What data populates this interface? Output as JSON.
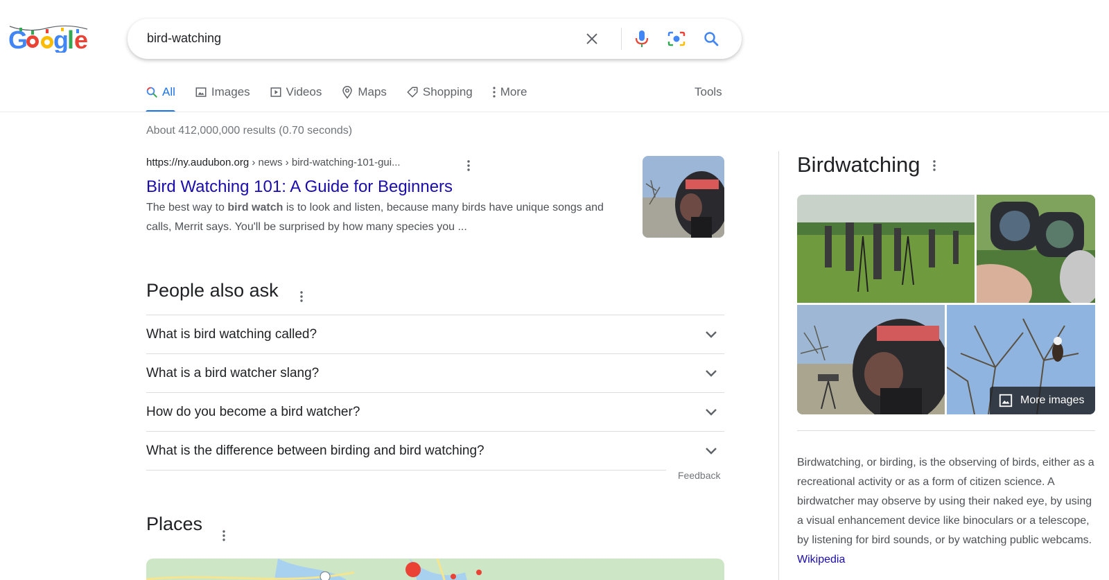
{
  "search": {
    "query": "bird-watching"
  },
  "tabs": [
    {
      "label": "All",
      "icon": "search-icon"
    },
    {
      "label": "Images",
      "icon": "image-icon"
    },
    {
      "label": "Videos",
      "icon": "video-icon"
    },
    {
      "label": "Maps",
      "icon": "map-pin-icon"
    },
    {
      "label": "Shopping",
      "icon": "tag-icon"
    },
    {
      "label": "More",
      "icon": "more-vert-icon"
    }
  ],
  "tools_label": "Tools",
  "stats": "About 412,000,000 results (0.70 seconds)",
  "result": {
    "domain": "https://ny.audubon.org",
    "path": " › news › bird-watching-101-gui...",
    "title": "Bird Watching 101: A Guide for Beginners",
    "snippet_pre": "The best way to ",
    "snippet_bold": "bird watch",
    "snippet_post": " is to look and listen, because many birds have unique songs and calls, Merrit says. You'll be surprised by how many species you ..."
  },
  "paa": {
    "title": "People also ask",
    "questions": [
      "What is bird watching called?",
      "What is a bird watcher slang?",
      "How do you become a bird watcher?",
      "What is the difference between birding and bird watching?"
    ],
    "feedback": "Feedback"
  },
  "places": {
    "title": "Places"
  },
  "knowledge_panel": {
    "title": "Birdwatching",
    "more_images": "More images",
    "description": "Birdwatching, or birding, is the observing of birds, either as a recreational activity or as a form of citizen science. A birdwatcher may observe by using their naked eye, by using a visual enhancement device like binoculars or a telescope, by listening for bird sounds, or by watching public webcams. ",
    "source_link": "Wikipedia"
  },
  "colors": {
    "link": "#1a0dab",
    "accent": "#1a73e8",
    "text": "#202124",
    "muted": "#70757a"
  }
}
